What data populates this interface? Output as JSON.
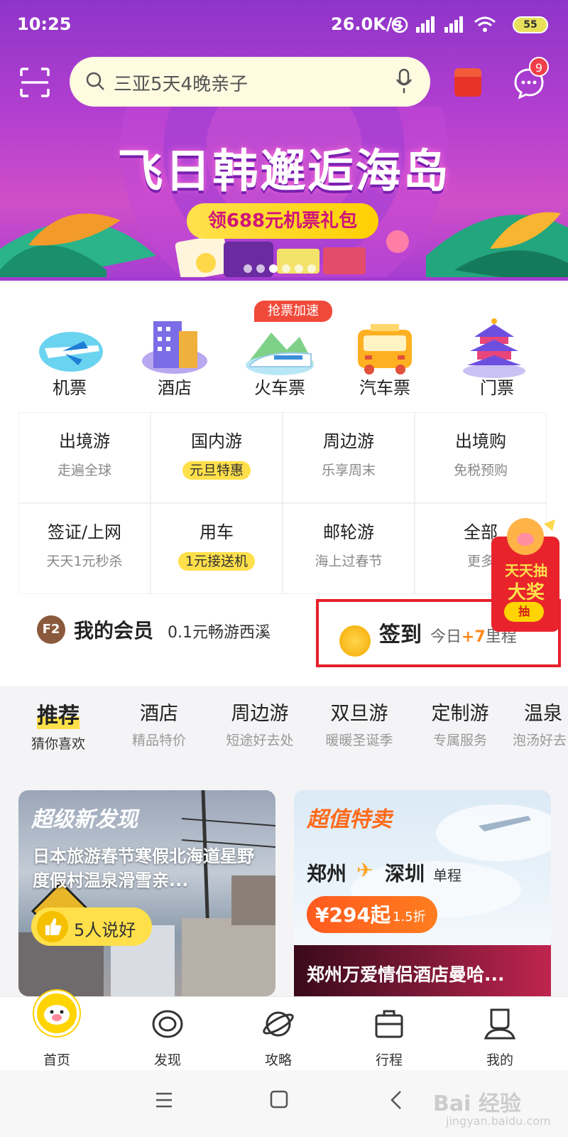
{
  "status_bar": {
    "time": "10:25",
    "speed": "26.0K/s",
    "battery": "55"
  },
  "search": {
    "placeholder": "三亚5天4晚亲子"
  },
  "messages": {
    "badge": "9"
  },
  "banner": {
    "title": "飞日韩邂逅海岛",
    "coupon": "领688元机票礼包"
  },
  "categories": [
    {
      "label": "机票",
      "icon": "plane-icon"
    },
    {
      "label": "酒店",
      "icon": "hotel-icon"
    },
    {
      "label": "火车票",
      "icon": "train-icon",
      "badge": "抢票加速"
    },
    {
      "label": "汽车票",
      "icon": "bus-icon"
    },
    {
      "label": "门票",
      "icon": "temple-icon"
    }
  ],
  "grid": [
    {
      "title": "出境游",
      "sub": "走遍全球"
    },
    {
      "title": "国内游",
      "sub": "元旦特惠",
      "highlight": true
    },
    {
      "title": "周边游",
      "sub": "乐享周末"
    },
    {
      "title": "出境购",
      "sub": "免税预购"
    },
    {
      "title": "签证/上网",
      "sub": "天天1元秒杀"
    },
    {
      "title": "用车",
      "sub": "1元接送机",
      "highlight": true
    },
    {
      "title": "邮轮游",
      "sub": "海上过春节"
    },
    {
      "title": "全部",
      "sub": "更多"
    }
  ],
  "lottery": {
    "line1": "天天抽",
    "line2": "大奖",
    "button": "抽"
  },
  "member": {
    "badge": "F2",
    "label": "我的会员",
    "desc": "0.1元畅游西溪"
  },
  "signin": {
    "label": "签到",
    "desc_prefix": "今日",
    "bonus": "+7",
    "desc_suffix": "里程"
  },
  "tabs": [
    {
      "title": "推荐",
      "sub": "猜你喜欢",
      "active": true
    },
    {
      "title": "酒店",
      "sub": "精品特价"
    },
    {
      "title": "周边游",
      "sub": "短途好去处"
    },
    {
      "title": "双旦游",
      "sub": "暖暖圣诞季"
    },
    {
      "title": "定制游",
      "sub": "专属服务"
    },
    {
      "title": "温泉",
      "sub": "泡汤好去"
    }
  ],
  "card_left": {
    "tag": "超级新发现",
    "title": "日本旅游春节寒假北海道星野度假村温泉滑雪亲...",
    "likes": "5人说好"
  },
  "card_right": {
    "tag": "超值特卖",
    "from": "郑州",
    "to": "深圳",
    "trip_type": "单程",
    "price": "¥294起",
    "discount": "1.5折",
    "hotel": "郑州万爱情侣酒店曼哈..."
  },
  "bottom_nav": [
    {
      "label": "首页",
      "icon": "pig-home-icon"
    },
    {
      "label": "发现",
      "icon": "eye-icon"
    },
    {
      "label": "攻略",
      "icon": "planet-icon"
    },
    {
      "label": "行程",
      "icon": "suitcase-icon"
    },
    {
      "label": "我的",
      "icon": "user-icon"
    }
  ],
  "watermark": {
    "text": "Bai 经验",
    "sub": "jingyan.baidu.com"
  },
  "colors": {
    "accent": "#ffe04a",
    "header": "#b33fd0",
    "highlight_box": "#e5202a",
    "orange": "#ff6a1a"
  }
}
